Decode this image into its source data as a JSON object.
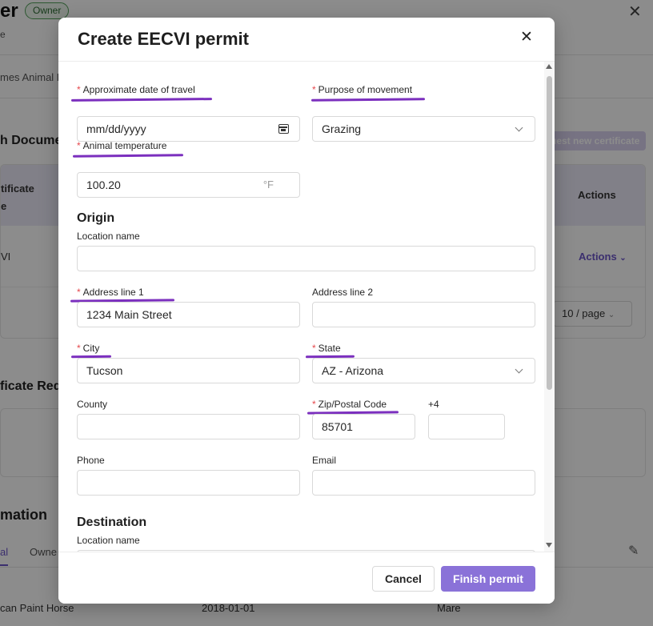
{
  "background": {
    "title_fragment": "er",
    "owner_badge": "Owner",
    "subtitle_fragment": "e",
    "animal_fragment": "mes Animal H",
    "health_documents_fragment": "h Docume",
    "request_button_fragment": "uest new certificate",
    "table": {
      "header_col1": "tificate e",
      "header_actions": "Actions",
      "row1_col1": "VI",
      "row1_actions": "Actions",
      "pager": "10 / page"
    },
    "certificate_requests_fragment": "ficate Requ",
    "information_fragment": "mation",
    "tabs": [
      "al",
      "Owne"
    ],
    "row": {
      "breed": "can Paint Horse",
      "date": "2018-01-01",
      "sex": "Mare"
    }
  },
  "modal": {
    "title": "Create EECVI permit",
    "fields": {
      "travel_date": {
        "label": "Approximate date of travel",
        "value": "mm/dd/yyyy"
      },
      "purpose": {
        "label": "Purpose of movement",
        "value": "Grazing"
      },
      "temperature": {
        "label": "Animal temperature",
        "value": "100.20",
        "unit": "°F"
      }
    },
    "origin": {
      "heading": "Origin",
      "location_name": {
        "label": "Location name",
        "value": ""
      },
      "address1": {
        "label": "Address line 1",
        "value": "1234 Main Street"
      },
      "address2": {
        "label": "Address line 2",
        "value": ""
      },
      "city": {
        "label": "City",
        "value": "Tucson"
      },
      "state": {
        "label": "State",
        "value": "AZ - Arizona"
      },
      "county": {
        "label": "County",
        "value": ""
      },
      "zip": {
        "label": "Zip/Postal Code",
        "value": "85701"
      },
      "plus4": {
        "label": "+4",
        "value": ""
      },
      "phone": {
        "label": "Phone",
        "value": ""
      },
      "email": {
        "label": "Email",
        "value": ""
      }
    },
    "destination": {
      "heading": "Destination",
      "location_name": {
        "label": "Location name",
        "value": ""
      }
    },
    "footer": {
      "cancel": "Cancel",
      "finish": "Finish permit"
    }
  },
  "colors": {
    "accent": "#8a72d8",
    "required_star": "#e5484d",
    "annotation_underline": "#7b2fbe"
  }
}
